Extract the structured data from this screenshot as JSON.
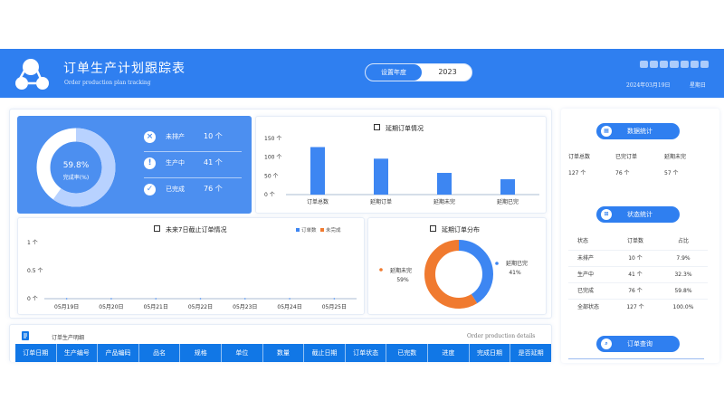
{
  "header": {
    "title": "订单生产计划跟踪表",
    "subtitle": "Order production plan tracking",
    "year_label": "设置年度",
    "year_value": "2023",
    "date": "2024年03月19日",
    "weekday": "星期日"
  },
  "summary": {
    "completion_percent": "59.8%",
    "completion_label": "完成率(%)",
    "completion_value": 0.598,
    "items": [
      {
        "label": "未排产",
        "value": "10 个",
        "icon": "x-circle-icon"
      },
      {
        "label": "生产中",
        "value": "41 个",
        "icon": "exclamation-icon"
      },
      {
        "label": "已完成",
        "value": "76 个",
        "icon": "check-icon"
      }
    ]
  },
  "delay_chart": {
    "title": "延期订单情况",
    "y_ticks": [
      "150 个",
      "100 个",
      "50 个",
      "0 个"
    ],
    "categories": [
      "订单总数",
      "延期订单",
      "延期未完",
      "延期已完"
    ],
    "values": [
      127,
      96,
      58,
      41
    ],
    "ylim": [
      0,
      150
    ],
    "color": "#3d86f2"
  },
  "next7": {
    "title": "未来7日截止订单情况",
    "legend": [
      "订单数",
      "未完成"
    ],
    "legend_colors": [
      "#3d86f2",
      "#f07a2f"
    ],
    "y_ticks": [
      "1 个",
      "0.5 个",
      "0 个"
    ],
    "dates": [
      "05月19日",
      "05月20日",
      "05月21日",
      "05月22日",
      "05月23日",
      "05月24日",
      "05月25日"
    ],
    "values": [
      0,
      0,
      0,
      0,
      0,
      0,
      0
    ]
  },
  "distribution": {
    "title": "延期订单分布",
    "slices": [
      {
        "label": "延期已完",
        "percent": "41%",
        "value": 41,
        "color": "#3d86f2"
      },
      {
        "label": "延期未完",
        "percent": "59%",
        "value": 59,
        "color": "#f07a2f"
      }
    ]
  },
  "details": {
    "title": "订单生产明细",
    "english": "Order production details",
    "columns": [
      "订单日期",
      "生产编号",
      "产品编码",
      "品名",
      "规格",
      "单位",
      "数量",
      "截止日期",
      "订单状态",
      "已完数",
      "进度",
      "完成日期",
      "是否延期"
    ]
  },
  "right": {
    "data_btn": "数据统计",
    "state_btn": "状态统计",
    "query_btn": "订单查询",
    "data_headers": [
      "订单总数",
      "已完订单",
      "延期未完"
    ],
    "data_values": [
      "127 个",
      "76 个",
      "57 个"
    ],
    "state_headers": [
      "状态",
      "订单数",
      "占比"
    ],
    "state_rows": [
      [
        "未排产",
        "10 个",
        "7.9%"
      ],
      [
        "生产中",
        "41 个",
        "32.3%"
      ],
      [
        "已完成",
        "76 个",
        "59.8%"
      ],
      [
        "全部状态",
        "127 个",
        "100.0%"
      ]
    ]
  }
}
